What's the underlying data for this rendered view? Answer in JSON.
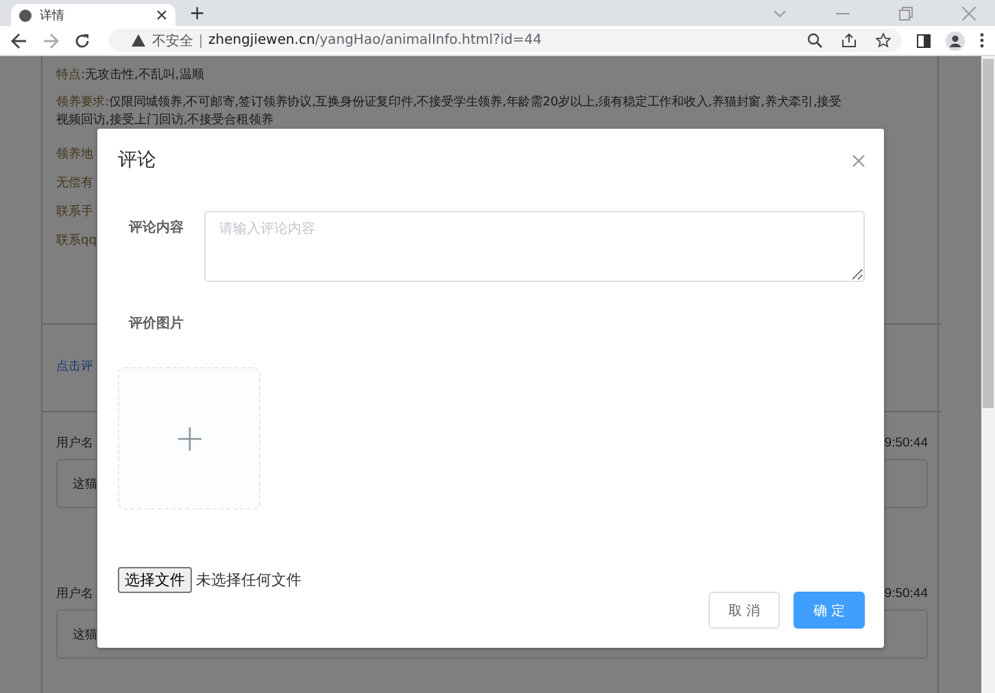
{
  "browser": {
    "tab_title": "详情",
    "new_tab": "+",
    "security": "不安全",
    "url_host": "zhengjiewen.cn",
    "url_path": "/yangHao/animalInfo.html?id=44"
  },
  "page": {
    "traits": {
      "label": "特点:",
      "value": "无攻击性,不乱叫,温顺"
    },
    "requirements": {
      "label": "领养要求:",
      "value_lines": [
        "仅限同城领养,不可邮寄,签订领养协议,互换身份证复印件,不接受学生领养,年龄需20岁以上,须有稳定工作和收入,养猫封窗,养犬牵引,接受",
        "视频回访,接受上门回访,不接受合租领养"
      ]
    },
    "info_lines": [
      "领养地",
      "无偿有",
      "联系手",
      "联系qq"
    ],
    "comment_link": "点击评",
    "comments": [
      {
        "user": "用户名",
        "time": "9:50:44",
        "text": "这猫"
      },
      {
        "user": "用户名",
        "time": "9:50:44",
        "text": "这猫"
      }
    ]
  },
  "dialog": {
    "title": "评论",
    "content_label": "评论内容",
    "content_placeholder": "请输入评论内容",
    "image_label": "评价图片",
    "file_button": "选择文件",
    "file_status": "未选择任何文件",
    "cancel": "取 消",
    "confirm": "确 定"
  }
}
